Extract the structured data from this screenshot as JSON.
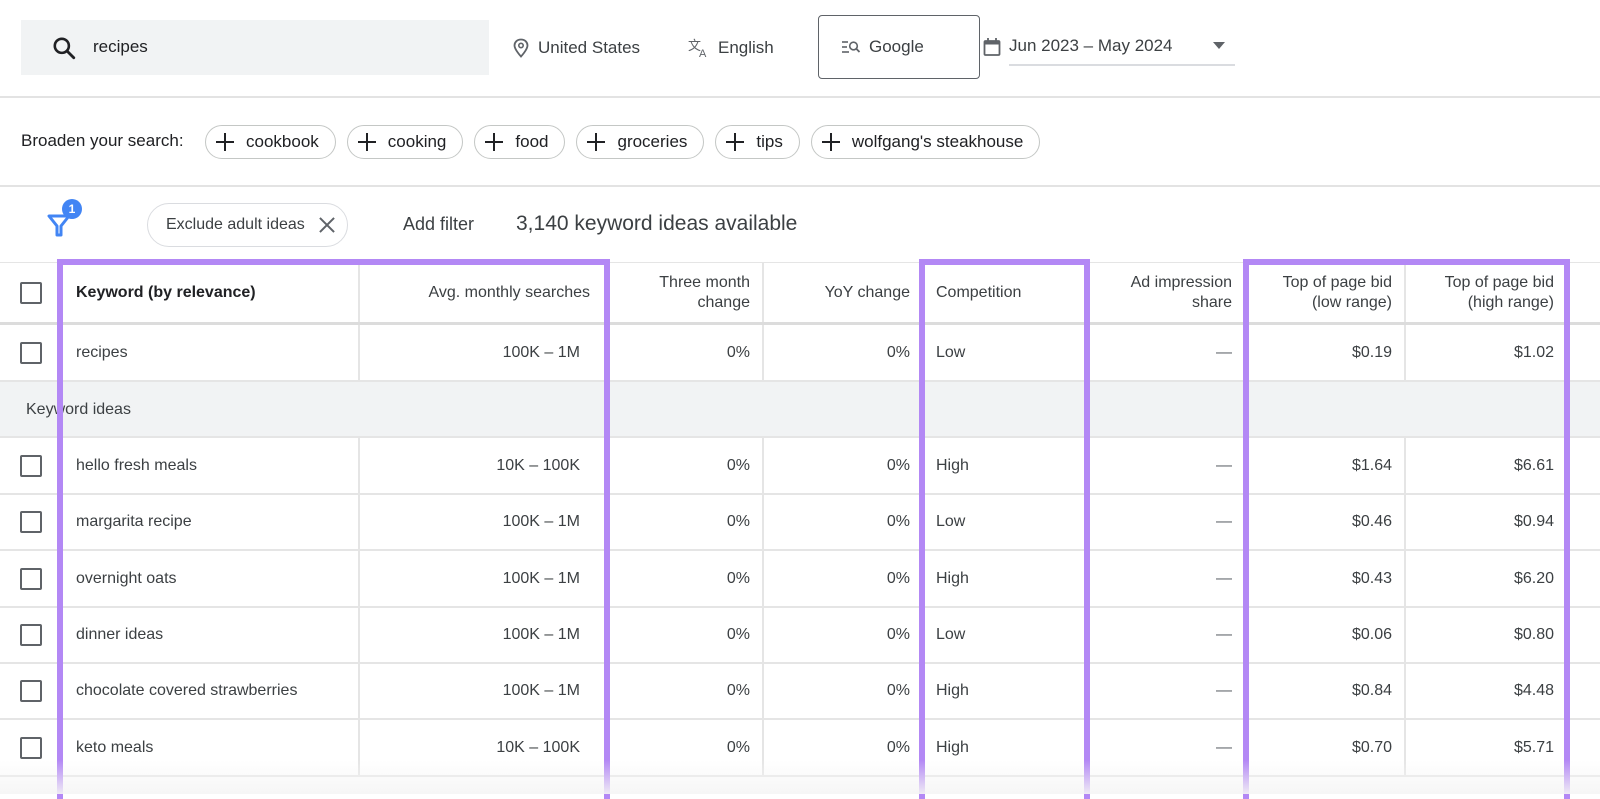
{
  "topbar": {
    "search_value": "recipes",
    "location": "United States",
    "language": "English",
    "search_engine": "Google",
    "date_range": "Jun 2023 – May 2024"
  },
  "broaden": {
    "label": "Broaden your search:",
    "chips": [
      "cookbook",
      "cooking",
      "food",
      "groceries",
      "tips",
      "wolfgang's steakhouse"
    ]
  },
  "filters": {
    "badge_count": "1",
    "active_filter": "Exclude adult ideas",
    "add_filter_label": "Add filter",
    "ideas_count_text": "3,140 keyword ideas available"
  },
  "table": {
    "headers": {
      "keyword": "Keyword (by relevance)",
      "avg_monthly": "Avg. monthly searches",
      "three_month_1": "Three month",
      "three_month_2": "change",
      "yoy": "YoY change",
      "competition": "Competition",
      "ad_impr_1": "Ad impression",
      "ad_impr_2": "share",
      "low_bid_1": "Top of page bid",
      "low_bid_2": "(low range)",
      "high_bid_1": "Top of page bid",
      "high_bid_2": "(high range)"
    },
    "seed_row": {
      "keyword": "recipes",
      "avg": "100K – 1M",
      "three_month": "0%",
      "yoy": "0%",
      "competition": "Low",
      "ad_share": "—",
      "low_bid": "$0.19",
      "high_bid": "$1.02"
    },
    "group_label": "Keyword ideas",
    "rows": [
      {
        "keyword": "hello fresh meals",
        "avg": "10K – 100K",
        "three_month": "0%",
        "yoy": "0%",
        "competition": "High",
        "ad_share": "—",
        "low_bid": "$1.64",
        "high_bid": "$6.61"
      },
      {
        "keyword": "margarita recipe",
        "avg": "100K – 1M",
        "three_month": "0%",
        "yoy": "0%",
        "competition": "Low",
        "ad_share": "—",
        "low_bid": "$0.46",
        "high_bid": "$0.94"
      },
      {
        "keyword": "overnight oats",
        "avg": "100K – 1M",
        "three_month": "0%",
        "yoy": "0%",
        "competition": "High",
        "ad_share": "—",
        "low_bid": "$0.43",
        "high_bid": "$6.20"
      },
      {
        "keyword": "dinner ideas",
        "avg": "100K – 1M",
        "three_month": "0%",
        "yoy": "0%",
        "competition": "Low",
        "ad_share": "—",
        "low_bid": "$0.06",
        "high_bid": "$0.80"
      },
      {
        "keyword": "chocolate covered strawberries",
        "avg": "100K – 1M",
        "three_month": "0%",
        "yoy": "0%",
        "competition": "High",
        "ad_share": "—",
        "low_bid": "$0.84",
        "high_bid": "$4.48"
      },
      {
        "keyword": "keto meals",
        "avg": "10K – 100K",
        "three_month": "0%",
        "yoy": "0%",
        "competition": "High",
        "ad_share": "—",
        "low_bid": "$0.70",
        "high_bid": "$5.71"
      }
    ]
  },
  "colors": {
    "highlight": "#b388f5",
    "filter_blue": "#4285f4",
    "search_bg": "#f1f3f4"
  }
}
